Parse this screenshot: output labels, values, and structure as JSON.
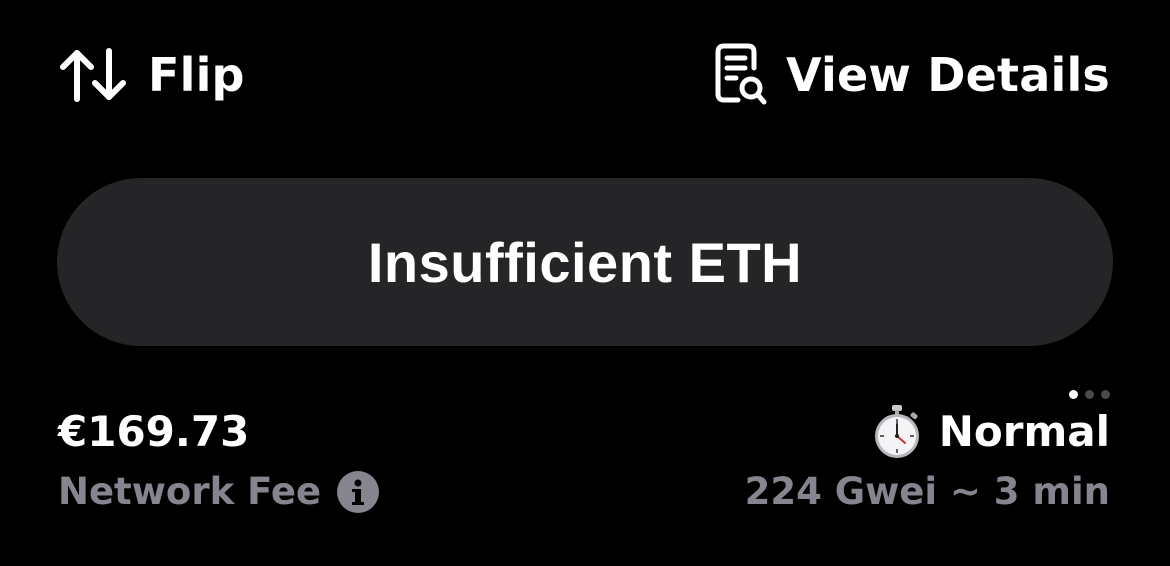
{
  "actions": {
    "flip_label": "Flip",
    "view_details_label": "View Details"
  },
  "main_button": {
    "label": "Insufficient ETH"
  },
  "fee": {
    "amount": "€169.73",
    "label": "Network Fee"
  },
  "speed": {
    "label": "Normal",
    "detail": "224 Gwei ~ 3 min"
  },
  "pager": {
    "count": 3,
    "active_index": 0
  },
  "icons": {
    "flip": "arrows-up-down-icon",
    "view_details": "receipt-search-icon",
    "info": "info-icon",
    "speed": "stopwatch-icon"
  },
  "colors": {
    "background": "#000000",
    "button_bg": "#252527",
    "primary_text": "#ffffff",
    "secondary_text": "#85858f"
  }
}
